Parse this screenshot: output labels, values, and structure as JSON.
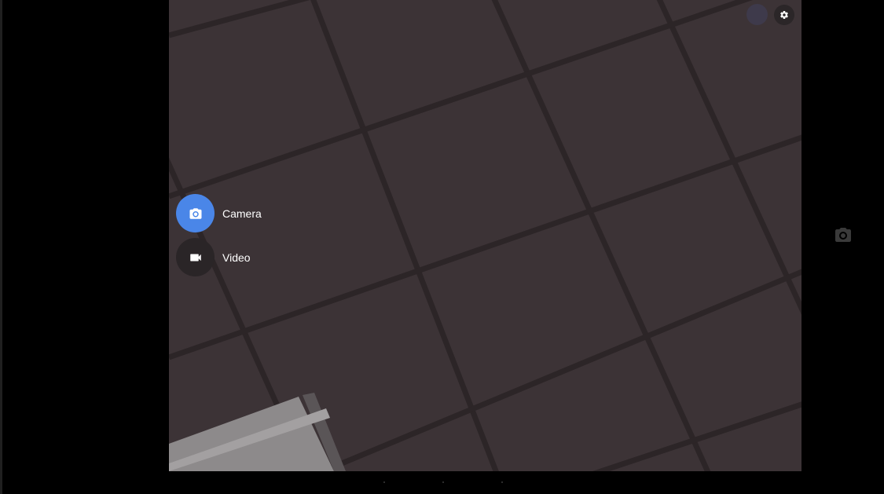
{
  "modes": {
    "camera": {
      "label": "Camera",
      "icon": "camera-icon",
      "active": true
    },
    "video": {
      "label": "Video",
      "icon": "videocam-icon",
      "active": false
    }
  },
  "toolbar": {
    "settings_icon": "gear-icon",
    "avatar_icon": "avatar"
  },
  "side_controls": {
    "shutter_icon": "camera-icon"
  },
  "colors": {
    "accent": "#4a86e8",
    "viewfinder_bg": "#3d3437",
    "inactive_mode": "#2a2527",
    "text": "#ffffff"
  }
}
